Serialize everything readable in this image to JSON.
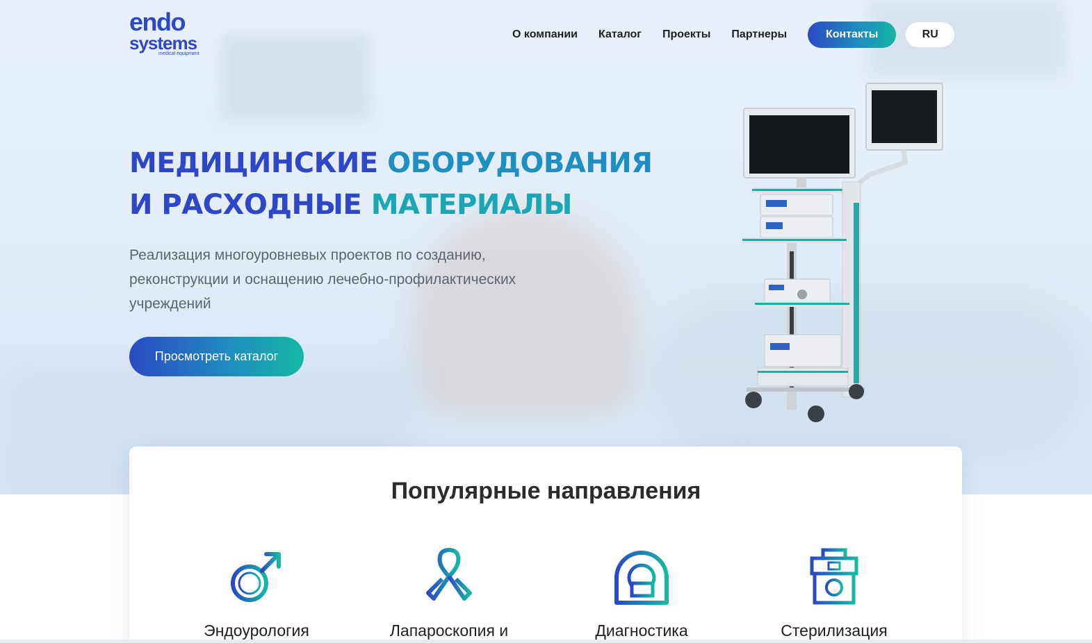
{
  "brand": {
    "line1": "endo",
    "line2": "systems",
    "tagline": "medical equipment",
    "primary_color": "#2d47c7",
    "accent_color": "#16b3a5"
  },
  "nav": {
    "items": [
      "О компании",
      "Каталог",
      "Проекты",
      "Партнеры"
    ],
    "contacts_label": "Контакты",
    "lang_label": "RU"
  },
  "hero": {
    "headline_part1": "МЕДИЦИНСКИЕ",
    "headline_part2": "ОБОРУДОВАНИЯ",
    "headline_part3": "И РАСХОДНЫЕ",
    "headline_part4": "МАТЕРИАЛЫ",
    "subtitle": "Реализация многоуровневых проектов по созданию, реконструкции и оснащению лечебно-профилактических учреждений",
    "cta_label": "Просмотреть каталог",
    "image_icon": "endoscopy-cart-image"
  },
  "popular": {
    "title": "Популярные направления",
    "items": [
      {
        "label": "Эндоурология",
        "icon": "male-symbol-icon"
      },
      {
        "label": "Лапароскопия и",
        "icon": "awareness-ribbon-icon"
      },
      {
        "label": "Диагностика",
        "icon": "mri-scanner-icon"
      },
      {
        "label": "Стерилизация",
        "icon": "sterilizer-icon"
      }
    ]
  }
}
